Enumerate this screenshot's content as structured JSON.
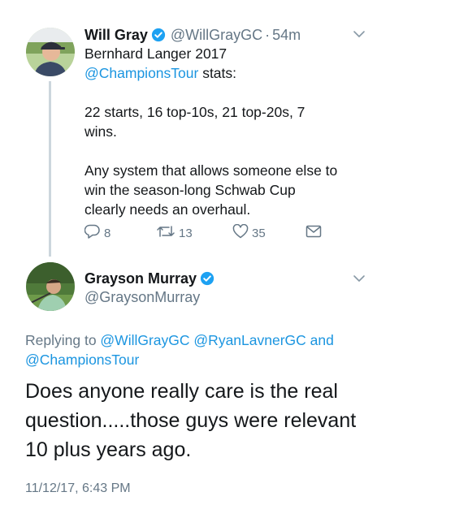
{
  "tweet1": {
    "author_name": "Will Gray",
    "author_handle": "@WillGrayGC",
    "separator": "·",
    "time_ago": "54m",
    "text_line1": "Bernhard Langer 2017",
    "mention": "@ChampionsTour",
    "text_line2_rest": " stats:",
    "stats_line1": "22 starts, 16 top-10s, 21 top-20s, 7",
    "stats_line2": "wins.",
    "para_line1": "Any system that allows someone else to",
    "para_line2": "win the season-long Schwab Cup",
    "para_line3": "clearly needs an overhaul.",
    "reply_count": "8",
    "retweet_count": "13",
    "like_count": "35"
  },
  "tweet2": {
    "author_name": "Grayson Murray",
    "author_handle": "@GraysonMurray",
    "replying_prefix": "Replying to ",
    "reply_mention1": "@WillGrayGC",
    "reply_mention2": "@RyanLavnerGC",
    "reply_and": " and",
    "reply_mention3": "@ChampionsTour",
    "text_line1": "Does anyone really care is the real",
    "text_line2": "question.....those guys were relevant",
    "text_line3": "10 plus years ago.",
    "timestamp": "11/12/17, 6:43 PM"
  },
  "icons": {
    "verified": "verified-badge-icon",
    "chevron": "chevron-down-icon",
    "reply": "reply-icon",
    "retweet": "retweet-icon",
    "like": "heart-icon",
    "dm": "envelope-icon"
  },
  "colors": {
    "link": "#1b95e0",
    "secondary": "#657786",
    "verified": "#1da1f2",
    "thread_line": "#ccd6dd"
  }
}
